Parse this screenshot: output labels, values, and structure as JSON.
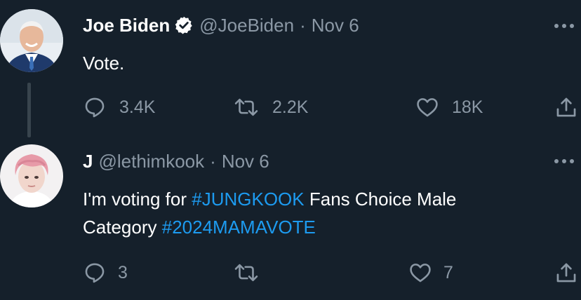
{
  "tweets": [
    {
      "author_name": "Joe Biden",
      "verified": true,
      "handle": "@JoeBiden",
      "separator": "·",
      "date": "Nov 6",
      "text": "Vote.",
      "replies": "3.4K",
      "retweets": "2.2K",
      "likes": "18K"
    },
    {
      "author_name": "J",
      "verified": false,
      "handle": "@lethimkook",
      "separator": "·",
      "date": "Nov 6",
      "text_part1": "I'm voting for ",
      "hashtag1": "#JUNGKOOK",
      "text_part2": " Fans Choice Male",
      "text_part3": "Category ",
      "hashtag2": "#2024MAMAVOTE",
      "replies": "3",
      "retweets": "",
      "likes": "7"
    }
  ],
  "colors": {
    "background": "#15202b",
    "secondary_text": "#8b98a5",
    "link": "#1d9bf0",
    "verified_badge": "#ffffff"
  },
  "icons": [
    "verified-badge-icon",
    "more-icon",
    "reply-icon",
    "retweet-icon",
    "like-icon",
    "share-icon"
  ]
}
